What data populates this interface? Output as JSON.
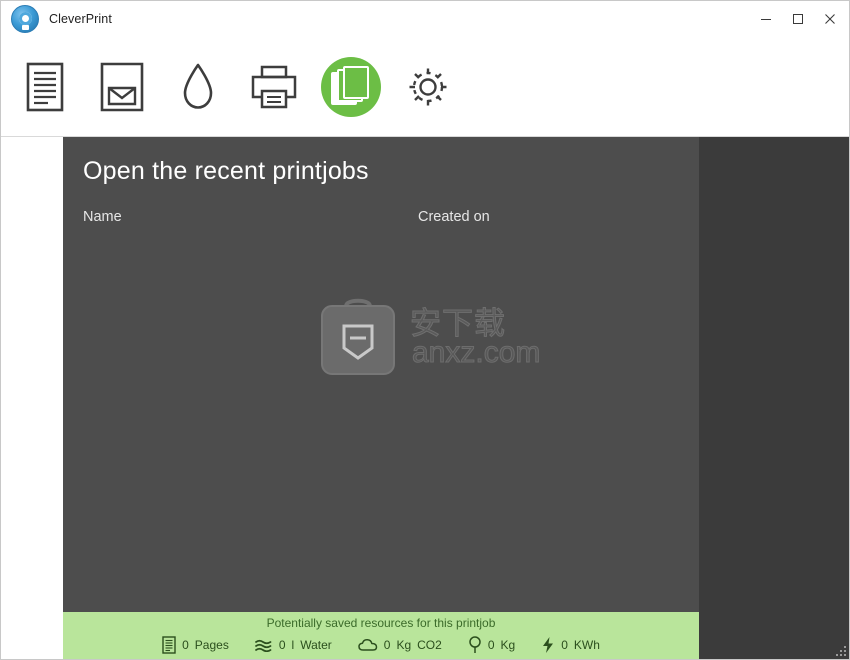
{
  "window": {
    "title": "CleverPrint",
    "logo_icon": "cleverprint-logo-icon",
    "controls": {
      "minimize_icon": "minimize-icon",
      "maximize_icon": "maximize-icon",
      "close_icon": "close-icon"
    }
  },
  "toolbar": {
    "items": [
      {
        "name": "document-preview",
        "icon": "document-lines-icon",
        "active": false
      },
      {
        "name": "email-document",
        "icon": "envelope-document-icon",
        "active": false
      },
      {
        "name": "ink-saving",
        "icon": "water-drop-icon",
        "active": false
      },
      {
        "name": "printer",
        "icon": "printer-icon",
        "active": false
      },
      {
        "name": "printjobs",
        "icon": "stacked-pages-icon",
        "active": true
      },
      {
        "name": "settings",
        "icon": "gear-icon",
        "active": false
      }
    ]
  },
  "main": {
    "title": "Open the recent printjobs",
    "columns": [
      {
        "label": "Name"
      },
      {
        "label": "Created on"
      }
    ],
    "rows": [],
    "watermark": {
      "line1": "安下载",
      "line2": "anxz.com"
    }
  },
  "footer": {
    "title": "Potentially saved resources for this printjob",
    "stats": [
      {
        "icon": "pages-icon",
        "value": "0",
        "unit": "Pages",
        "label": ""
      },
      {
        "icon": "water-waves-icon",
        "value": "0",
        "unit": "l",
        "label": "Water"
      },
      {
        "icon": "cloud-icon",
        "value": "0",
        "unit": "Kg",
        "label": "CO2"
      },
      {
        "icon": "tree-icon",
        "value": "0",
        "unit": "Kg",
        "label": ""
      },
      {
        "icon": "lightning-icon",
        "value": "0",
        "unit": "KWh",
        "label": ""
      }
    ]
  },
  "colors": {
    "accent_green": "#6cbe45",
    "footer_green": "#b9e59b",
    "content_bg": "#4d4d4d",
    "panel_bg": "#3b3b3b"
  }
}
